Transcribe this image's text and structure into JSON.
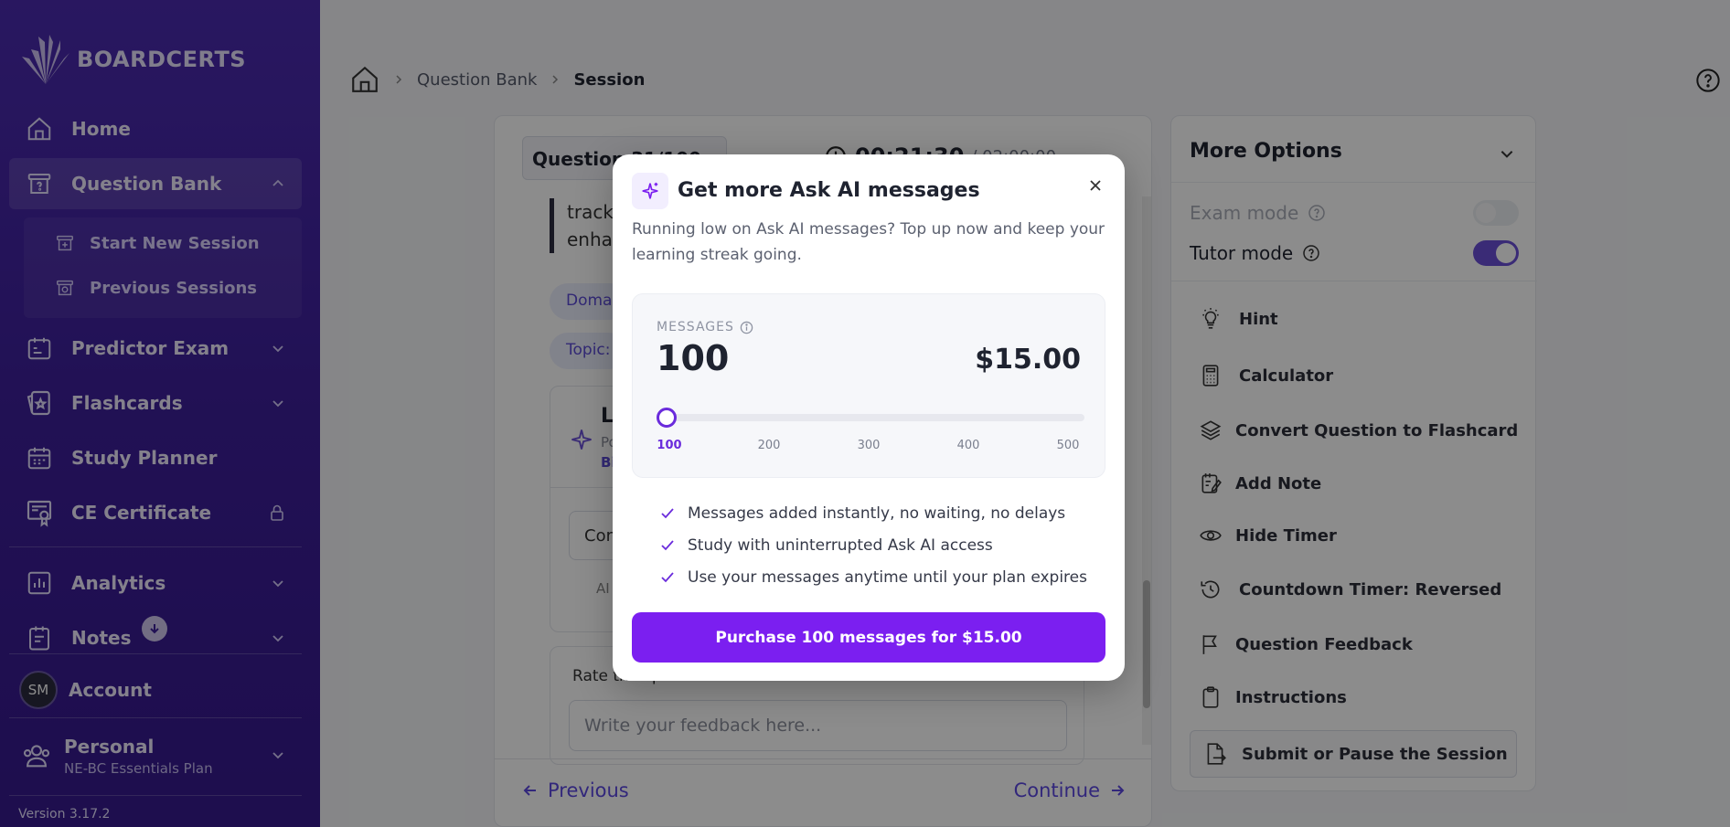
{
  "brand": {
    "name": "BOARDCERTS"
  },
  "sidebar": {
    "items": [
      {
        "label": "Home",
        "icon": "home-icon"
      },
      {
        "label": "Question Bank",
        "icon": "question-bank-icon"
      },
      {
        "label": "Predictor Exam",
        "icon": "predictor-icon"
      },
      {
        "label": "Flashcards",
        "icon": "flashcards-icon"
      },
      {
        "label": "Study Planner",
        "icon": "calendar-icon"
      },
      {
        "label": "CE Certificate",
        "icon": "certificate-icon"
      },
      {
        "label": "Analytics",
        "icon": "analytics-icon"
      },
      {
        "label": "Notes",
        "icon": "notes-icon"
      }
    ],
    "subitems": [
      {
        "label": "Start New Session"
      },
      {
        "label": "Previous Sessions"
      }
    ],
    "account": {
      "label": "Account",
      "initials": "SM"
    },
    "plan": {
      "title": "Personal",
      "subtitle": "NE-BC Essentials Plan"
    },
    "version": "Version 3.17.2"
  },
  "breadcrumb": {
    "parent": "Question Bank",
    "current": "Session"
  },
  "question": {
    "selector": "Question 31/100",
    "timer": "00:21:30",
    "timer_total": "/ 02:00:00",
    "text_line1": "track",
    "text_line2": "enha",
    "chip_domain": "Doma",
    "chip_topic": "Topic:",
    "ai_card_title": "L",
    "ai_card_sub1": "Po",
    "ai_card_sub2": "Bi",
    "ai_card_input": "Cor",
    "ai_card_note": "AI",
    "rate_label": "Rate this question:",
    "feedback_placeholder": "Write your feedback here...",
    "prev_label": "Previous",
    "next_label": "Continue"
  },
  "options": {
    "title": "More Options",
    "exam_mode": "Exam mode",
    "tutor_mode": "Tutor mode",
    "exam_mode_on": false,
    "tutor_mode_on": true,
    "items": [
      {
        "label": "Hint",
        "icon": "lightbulb-icon"
      },
      {
        "label": "Calculator",
        "icon": "calculator-icon"
      },
      {
        "label": "Convert Question to Flashcard",
        "icon": "layers-icon"
      },
      {
        "label": "Add Note",
        "icon": "note-edit-icon"
      },
      {
        "label": "Hide Timer",
        "icon": "eye-icon"
      },
      {
        "label": "Countdown Timer: Reversed",
        "icon": "history-icon"
      },
      {
        "label": "Question Feedback",
        "icon": "flag-icon"
      },
      {
        "label": "Instructions",
        "icon": "clipboard-icon"
      }
    ],
    "submit_label": "Submit or Pause the Session"
  },
  "modal": {
    "title": "Get more Ask AI messages",
    "description": "Running low on Ask AI messages? Top up now and keep your learning streak going.",
    "messages_label": "MESSAGES",
    "messages_count": "100",
    "price": "$15.00",
    "slider_ticks": [
      "100",
      "200",
      "300",
      "400",
      "500"
    ],
    "slider_value": 100,
    "features": [
      "Messages added instantly, no waiting, no delays",
      "Study with uninterrupted Ask AI access",
      "Use your messages anytime until your plan expires"
    ],
    "purchase_label": "Purchase 100 messages for $15.00"
  },
  "colors": {
    "sidebar": "#4b2bb0",
    "accent": "#7b1ff0",
    "toggle_on": "#6a4fd8"
  }
}
